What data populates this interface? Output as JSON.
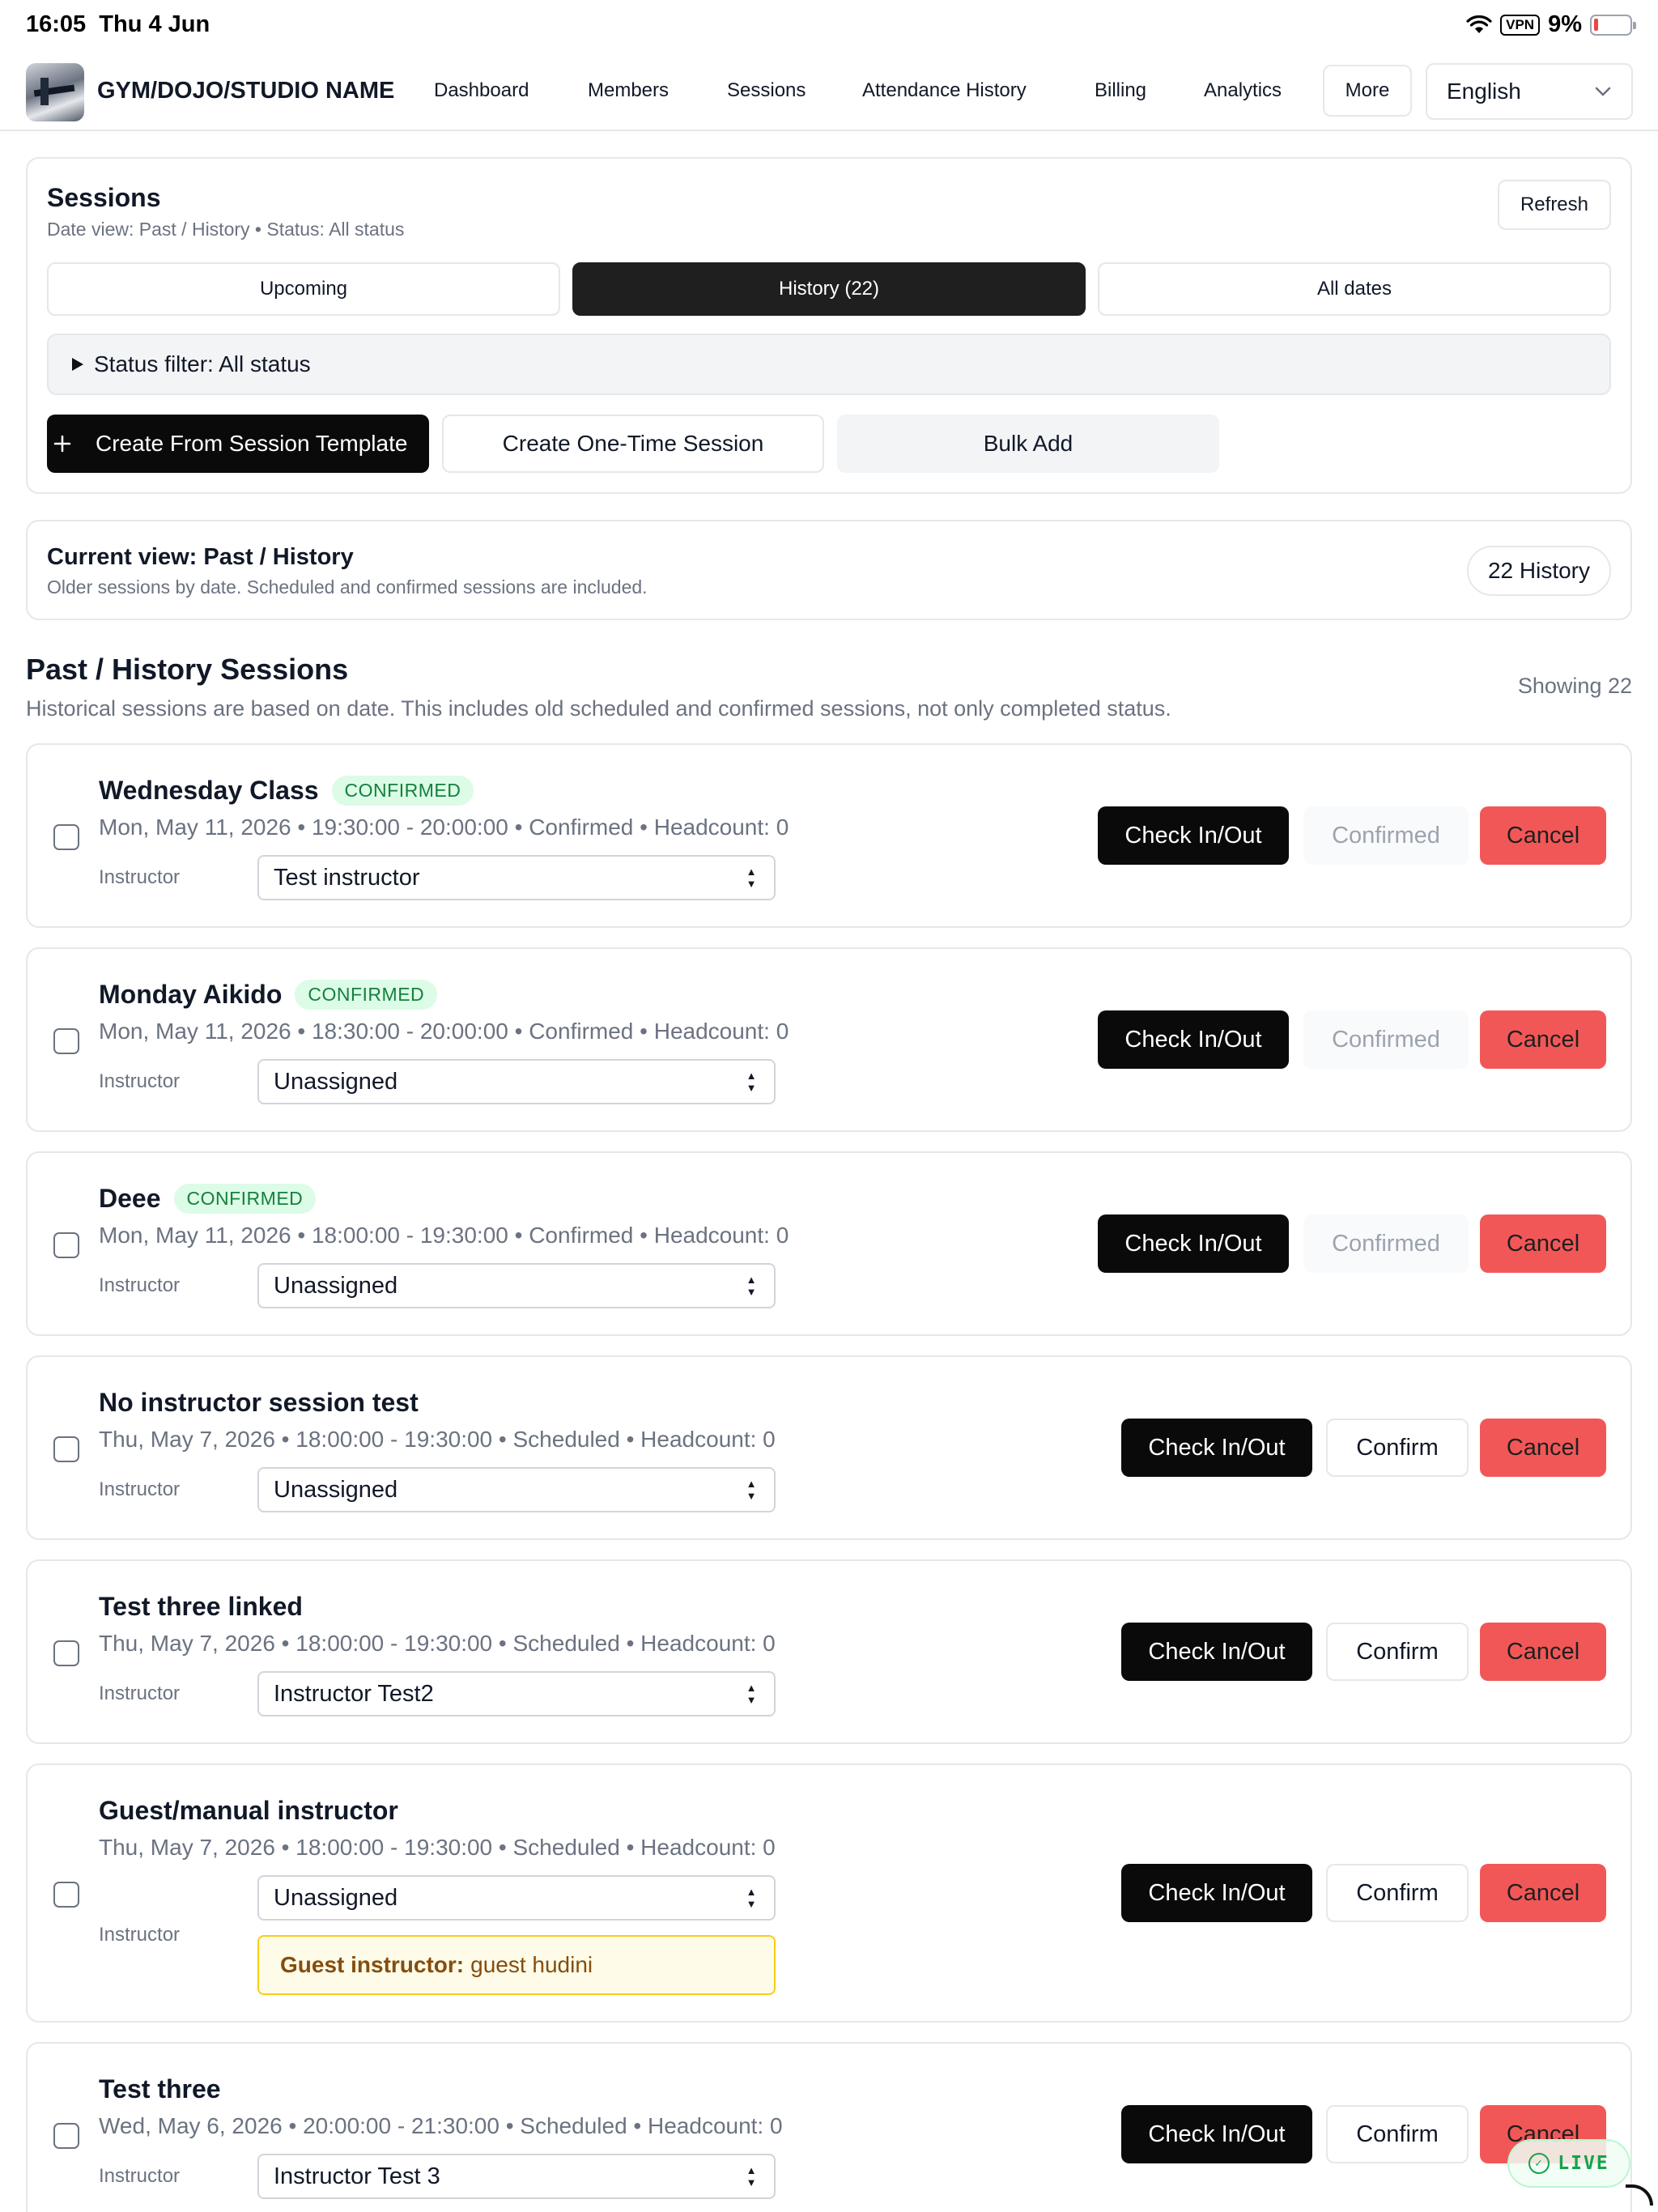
{
  "status_bar": {
    "time": "16:05",
    "date": "Thu 4 Jun",
    "vpn": "VPN",
    "battery": "9%"
  },
  "nav": {
    "brand": "GYM/DOJO/STUDIO NAME",
    "links": [
      "Dashboard",
      "Members",
      "Sessions",
      "Attendance History",
      "Billing",
      "Analytics"
    ],
    "more": "More",
    "language": "English"
  },
  "sessions_panel": {
    "title": "Sessions",
    "subtitle": "Date view: Past / History • Status: All status",
    "refresh": "Refresh",
    "tabs": [
      "Upcoming",
      "History (22)",
      "All dates"
    ],
    "filter": "Status filter: All status",
    "actions": {
      "template": "Create From Session Template",
      "one_time": "Create One-Time Session",
      "bulk": "Bulk Add"
    }
  },
  "current_view": {
    "title": "Current view: Past / History",
    "subtitle": "Older sessions by date. Scheduled and confirmed sessions are included.",
    "count_pill": "22 History"
  },
  "section": {
    "title": "Past / History Sessions",
    "subtitle": "Historical sessions are based on date. This includes old scheduled and confirmed sessions, not only completed status.",
    "count": "Showing 22"
  },
  "instructor_label": "Instructor",
  "button_labels": {
    "checkin": "Check In/Out",
    "confirmed": "Confirmed",
    "confirm": "Confirm",
    "cancel": "Cancel"
  },
  "sessions": [
    {
      "name": "Wednesday Class",
      "badge": "CONFIRMED",
      "meta": "Mon, May 11, 2026 • 19:30:00 - 20:00:00 • Confirmed • Headcount: 0",
      "instructor": "Test instructor"
    },
    {
      "name": "Monday Aikido",
      "badge": "CONFIRMED",
      "meta": "Mon, May 11, 2026 • 18:30:00 - 20:00:00 • Confirmed • Headcount: 0",
      "instructor": "Unassigned"
    },
    {
      "name": "Deee",
      "badge": "CONFIRMED",
      "meta": "Mon, May 11, 2026 • 18:00:00 - 19:30:00 • Confirmed • Headcount: 0",
      "instructor": "Unassigned"
    },
    {
      "name": "No instructor session test",
      "badge": "",
      "meta": "Thu, May 7, 2026 • 18:00:00 - 19:30:00 • Scheduled • Headcount: 0",
      "instructor": "Unassigned"
    },
    {
      "name": "Test three linked",
      "badge": "",
      "meta": "Thu, May 7, 2026 • 18:00:00 - 19:30:00 • Scheduled • Headcount: 0",
      "instructor": "Instructor Test2"
    },
    {
      "name": "Guest/manual instructor",
      "badge": "",
      "meta": "Thu, May 7, 2026 • 18:00:00 - 19:30:00 • Scheduled • Headcount: 0",
      "instructor": "Unassigned",
      "guest_label": "Guest instructor:",
      "guest_name": "guest hudini"
    },
    {
      "name": "Test three",
      "badge": "",
      "meta": "Wed, May 6, 2026 • 20:00:00 - 21:30:00 • Scheduled • Headcount: 0",
      "instructor": "Instructor Test 3"
    }
  ],
  "live_badge": "LIVE",
  "colors": {
    "primary": "#0a0a0a",
    "danger": "#f25757",
    "success_badge_bg": "#dcfce7",
    "success_badge_text": "#15803d",
    "border": "#e5e7eb"
  }
}
